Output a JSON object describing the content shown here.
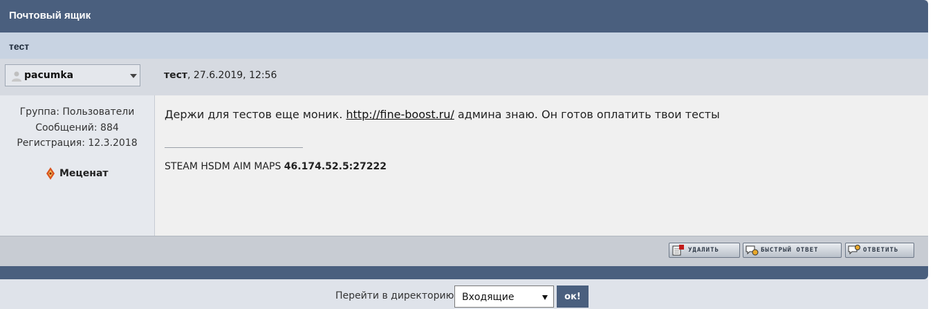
{
  "window": {
    "title": "Почтовый ящик"
  },
  "message": {
    "subject": "тест",
    "author": "pacumka",
    "meta_title": "тест",
    "meta_date": ", 27.6.2019, 12:56",
    "body_before": "Держи для тестов еще моник. ",
    "body_link": "http://fine-boost.ru/",
    "body_after": " админа знаю. Он готов оплатить твои тесты",
    "signature_text": "STEAM HSDM AIM MAPS ",
    "signature_ip": "46.174.52.5:27222"
  },
  "profile": {
    "group": "Группа: Пользователи",
    "posts": "Сообщений: 884",
    "registered": "Регистрация: 12.3.2018",
    "rank": "Меценат"
  },
  "actions": {
    "delete": "УДАЛИТЬ",
    "quick_reply": "БЫСТРЫЙ ОТВЕТ",
    "reply": "ОТВЕТИТЬ"
  },
  "footer": {
    "goto_label": "Перейти в директорию:",
    "folder_selected": "Входящие",
    "ok": "ок!"
  },
  "colors": {
    "header": "#4a5f7e",
    "subject_bar": "#c8d3e2",
    "post_bg": "#f0f0f0"
  }
}
